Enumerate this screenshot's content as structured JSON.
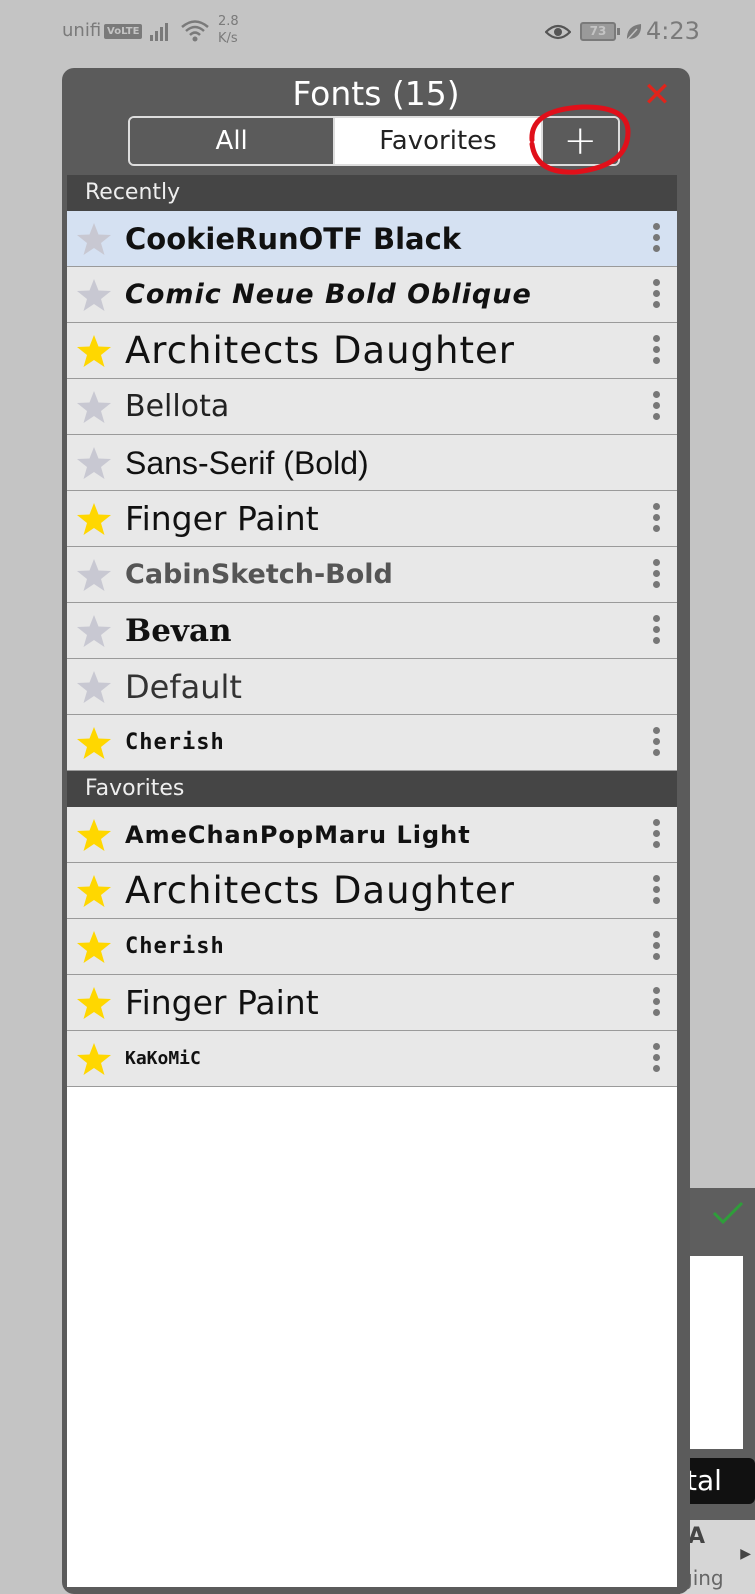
{
  "status_bar": {
    "carrier": "unifi",
    "volte": "VoLTE",
    "speed_value": "2.8",
    "speed_unit": "K/s",
    "battery": "73",
    "time": "4:23"
  },
  "dialog": {
    "title": "Fonts (15)",
    "close_symbol": "✕",
    "tabs": [
      {
        "label": "All",
        "selected": false
      },
      {
        "label": "Favorites",
        "selected": true
      }
    ],
    "add_symbol": "+",
    "annotation_color": "#e0101a"
  },
  "sections": {
    "recently": {
      "header": "Recently",
      "items": [
        {
          "name": "CookieRunOTF Black",
          "favorite": false,
          "menu": true,
          "selected": true
        },
        {
          "name": "Comic Neue Bold Oblique",
          "favorite": false,
          "menu": true
        },
        {
          "name": "Architects Daughter",
          "favorite": true,
          "menu": true
        },
        {
          "name": "Bellota",
          "favorite": false,
          "menu": true
        },
        {
          "name": "Sans-Serif (Bold)",
          "favorite": false,
          "menu": false
        },
        {
          "name": "Finger Paint",
          "favorite": true,
          "menu": true
        },
        {
          "name": "CabinSketch-Bold",
          "favorite": false,
          "menu": true
        },
        {
          "name": "Bevan",
          "favorite": false,
          "menu": true
        },
        {
          "name": "Default",
          "favorite": false,
          "menu": false
        },
        {
          "name": "Cherish",
          "favorite": true,
          "menu": true
        }
      ]
    },
    "favorites": {
      "header": "Favorites",
      "items": [
        {
          "name": "AmeChanPopMaru Light",
          "favorite": true,
          "menu": true
        },
        {
          "name": "Architects Daughter",
          "favorite": true,
          "menu": true
        },
        {
          "name": "Cherish",
          "favorite": true,
          "menu": true
        },
        {
          "name": "Finger Paint",
          "favorite": true,
          "menu": true
        },
        {
          "name": "KaKoMiC",
          "favorite": true,
          "menu": true
        }
      ]
    }
  },
  "background_panel": {
    "button_text": "tal",
    "label_top": "A",
    "label_bottom": "ging"
  },
  "colors": {
    "star_on": "#ffd700",
    "star_off": "#c8c8d2",
    "selected_row": "#d5e1f2",
    "close_red": "#e0241b",
    "check_green": "#2e9e3a"
  }
}
